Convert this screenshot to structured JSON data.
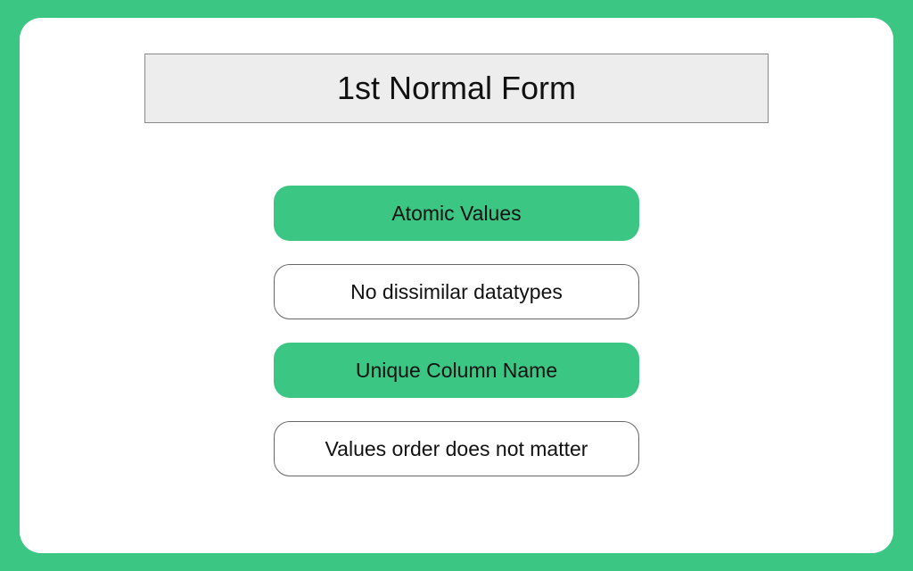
{
  "title": "1st Normal Form",
  "items": [
    {
      "label": "Atomic Values",
      "style": "filled"
    },
    {
      "label": "No dissimilar datatypes",
      "style": "outline"
    },
    {
      "label": "Unique Column Name",
      "style": "filled"
    },
    {
      "label": "Values order does not matter",
      "style": "outline"
    }
  ],
  "colors": {
    "accent": "#3cc684",
    "titleBg": "#ededed"
  }
}
